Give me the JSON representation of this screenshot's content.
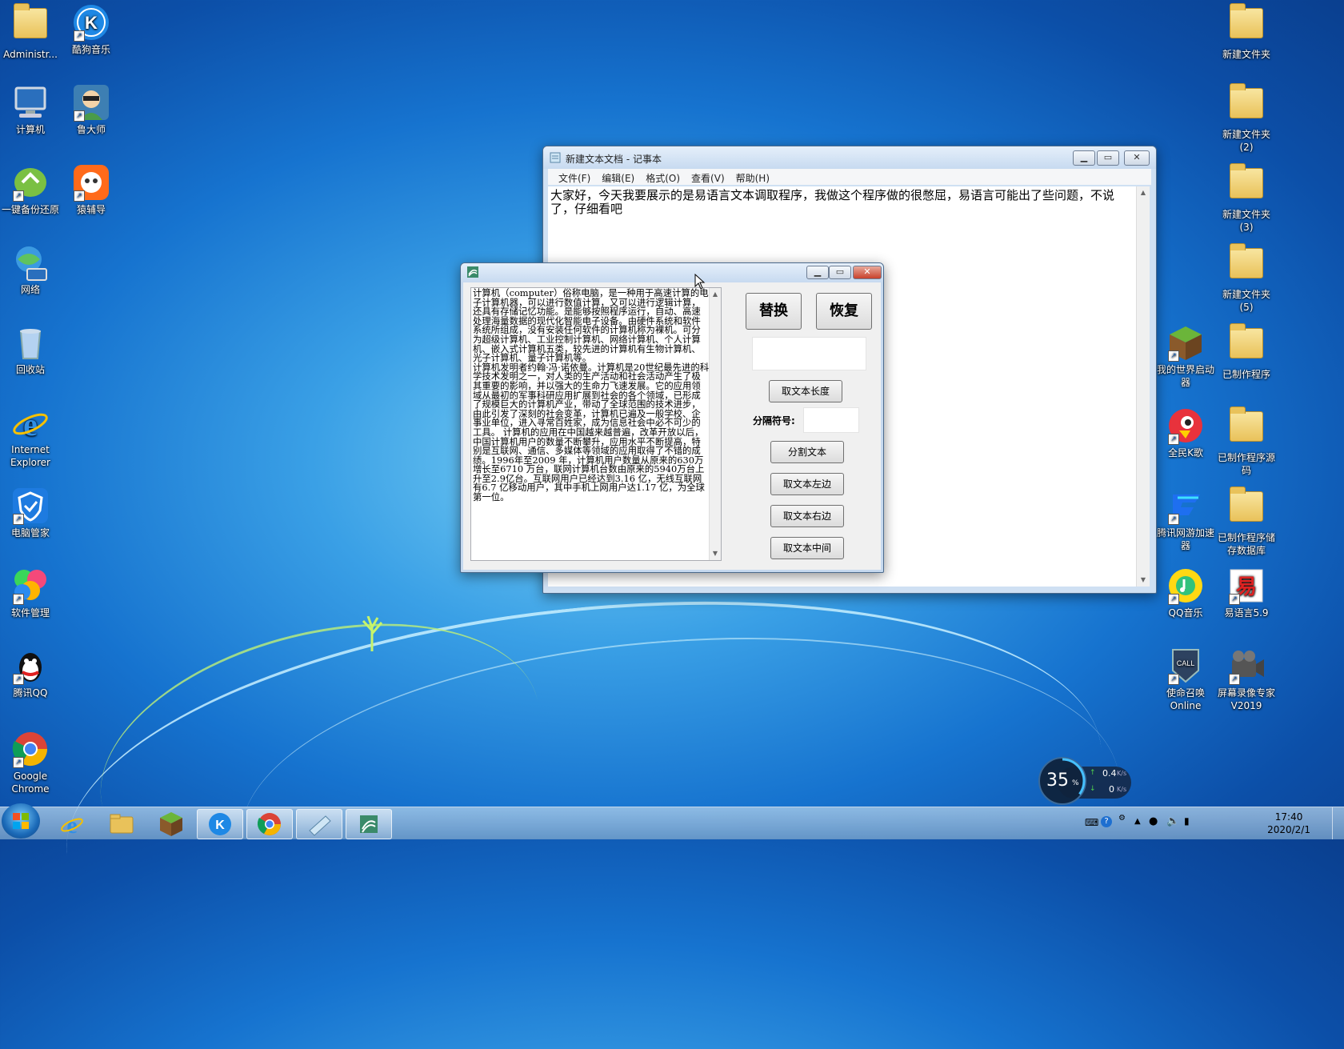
{
  "desktop": {
    "left_icons": [
      {
        "label": "Administr...",
        "icon": "user-folder-icon"
      },
      {
        "label": "酷狗音乐",
        "icon": "kugou-icon"
      },
      {
        "label": "计算机",
        "icon": "computer-icon"
      },
      {
        "label": "鲁大师",
        "icon": "ludashi-icon"
      },
      {
        "label": "一键备份还原",
        "icon": "backup-icon"
      },
      {
        "label": "猿辅导",
        "icon": "yuanfudao-icon"
      },
      {
        "label": "网络",
        "icon": "network-icon"
      },
      {
        "label": "回收站",
        "icon": "recycle-bin-icon"
      },
      {
        "label": "Internet Explorer",
        "icon": "ie-icon"
      },
      {
        "label": "电脑管家",
        "icon": "pc-manager-icon"
      },
      {
        "label": "软件管理",
        "icon": "software-manager-icon"
      },
      {
        "label": "腾讯QQ",
        "icon": "qq-icon"
      },
      {
        "label": "Google Chrome",
        "icon": "chrome-icon"
      }
    ],
    "right_icons": [
      {
        "label": "新建文件夹",
        "icon": "folder-icon"
      },
      {
        "label": "新建文件夹 (2)",
        "icon": "folder-icon"
      },
      {
        "label": "新建文件夹 (3)",
        "icon": "folder-icon"
      },
      {
        "label": "新建文件夹 (5)",
        "icon": "folder-icon"
      },
      {
        "label": "我的世界启动器",
        "icon": "minecraft-icon"
      },
      {
        "label": "已制作程序",
        "icon": "folder-icon"
      },
      {
        "label": "全民K歌",
        "icon": "ksong-icon"
      },
      {
        "label": "已制作程序源码",
        "icon": "folder-icon"
      },
      {
        "label": "腾讯网游加速器",
        "icon": "game-accelerator-icon"
      },
      {
        "label": "已制作程序储存数据库",
        "icon": "folder-icon"
      },
      {
        "label": "QQ音乐",
        "icon": "qqmusic-icon"
      },
      {
        "label": "易语言5.9",
        "icon": "eyuyan-icon"
      },
      {
        "label": "使命召唤Online",
        "icon": "cod-icon"
      },
      {
        "label": "屏幕录像专家V2019",
        "icon": "screen-recorder-icon"
      }
    ]
  },
  "notepad": {
    "title": "新建文本文档 - 记事本",
    "menu": [
      "文件(F)",
      "编辑(E)",
      "格式(O)",
      "查看(V)",
      "帮助(H)"
    ],
    "content": "大家好，今天我要展示的是易语言文本调取程序，我做这个程序做的很憋屈，易语言可能出了些问题，不说了，仔细看吧"
  },
  "app": {
    "title": "",
    "text": "计算机（computer）俗称电脑，是一种用于高速计算的电子计算机器，可以进行数值计算，又可以进行逻辑计算，还具有存储记忆功能。是能够按照程序运行，自动、高速处理海量数据的现代化智能电子设备。由硬件系统和软件系统所组成，没有安装任何软件的计算机称为裸机。可分为超级计算机、工业控制计算机、网络计算机、个人计算机、嵌入式计算机五类，较先进的计算机有生物计算机、光子计算机、量子计算机等。\n计算机发明者约翰·冯·诺依曼。计算机是20世纪最先进的科学技术发明之一，对人类的生产活动和社会活动产生了极其重要的影响，并以强大的生命力飞速发展。它的应用领域从最初的军事科研应用扩展到社会的各个领域，已形成了规模巨大的计算机产业，带动了全球范围的技术进步，由此引发了深刻的社会变革，计算机已遍及一般学校、企事业单位，进入寻常百姓家，成为信息社会中必不可少的工具。 计算机的应用在中国越来越普遍，改革开放以后，中国计算机用户的数量不断攀升，应用水平不断提高，特别是互联网、通信、多媒体等领域的应用取得了不错的成绩。1996年至2009 年，计算机用户数量从原来的630万增长至6710 万台，联网计算机台数由原来的5940万台上升至2.9亿台。互联网用户已经达到3.16 亿，无线互联网有6.7 亿移动用户，其中手机上网用户达1.17 亿，为全球第一位。",
    "replace_btn": "替换",
    "restore_btn": "恢复",
    "result_value": "",
    "length_btn": "取文本长度",
    "separator_label": "分隔符号:",
    "separator_value": "",
    "split_btn": "分割文本",
    "left_btn": "取文本左边",
    "right_btn": "取文本右边",
    "middle_btn": "取文本中间"
  },
  "netspeed": {
    "percent": "35",
    "percent_unit": "%",
    "up": "0.4",
    "down": "0",
    "unit": "K/s"
  },
  "taskbar": {
    "items": [
      "ie-icon",
      "explorer-icon",
      "minecraft-icon",
      "kugou-icon",
      "chrome-icon",
      "notepad-icon",
      "eyuyan-app-icon"
    ],
    "time": "17:40",
    "date": "2020/2/1"
  }
}
